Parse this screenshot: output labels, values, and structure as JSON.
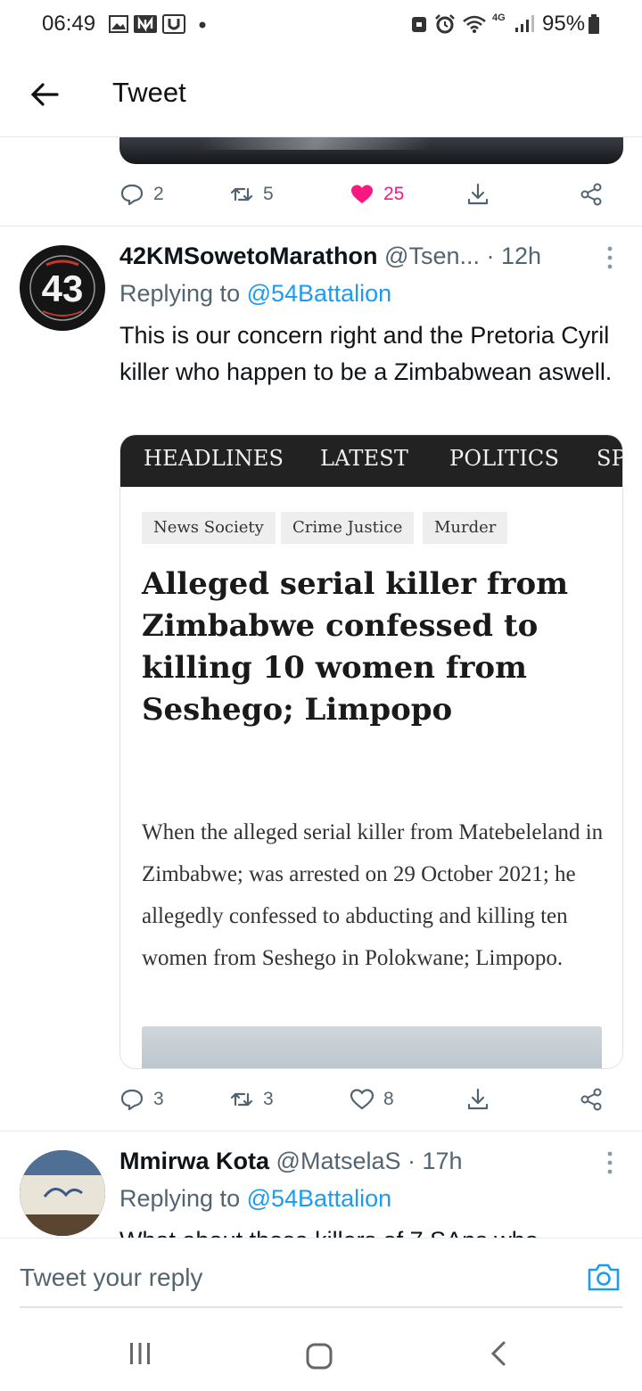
{
  "status_bar": {
    "time": "06:49",
    "battery_percent": "95%",
    "network": "4G"
  },
  "header": {
    "title": "Tweet"
  },
  "prev_tweet_actions": {
    "replies": "2",
    "retweets": "5",
    "likes": "25",
    "liked": true,
    "like_color": "#f91880"
  },
  "tweet": {
    "author_name": "42KMSowetoMarathon",
    "author_handle": "@Tsen...",
    "time_ago": "· 12h",
    "avatar_number": "43",
    "replying_prefix": "Replying to",
    "replying_to": "@54Battalion",
    "text": "This is our concern right and the Pretoria Cyril killer who happen to be a Zimbabwean aswell.",
    "card": {
      "nav": [
        "HEADLINES",
        "LATEST",
        "POLITICS",
        "SP"
      ],
      "tags": [
        "News Society",
        "Crime Justice",
        "Murder"
      ],
      "title": "Alleged serial killer from Zimbabwe confessed to killing 10 women from Seshego; Limpopo",
      "body": "When the alleged serial killer from Matebeleland in Zimbabwe; was arrested on 29 October 2021; he allegedly confessed to abducting and killing ten women from Seshego in Polokwane; Limpopo."
    },
    "actions": {
      "replies": "3",
      "retweets": "3",
      "likes": "8"
    }
  },
  "next_tweet": {
    "author_name": "Mmirwa Kota",
    "author_handle": "@MatselaS",
    "time_ago": "· 17h",
    "replying_prefix": "Replying to",
    "replying_to": "@54Battalion",
    "text_partial": "What about those killers of 7 SAps who"
  },
  "reply_bar": {
    "placeholder": "Tweet your reply"
  },
  "colors": {
    "accent": "#1d9bf0",
    "secondary_text": "#536471",
    "like": "#f91880"
  }
}
